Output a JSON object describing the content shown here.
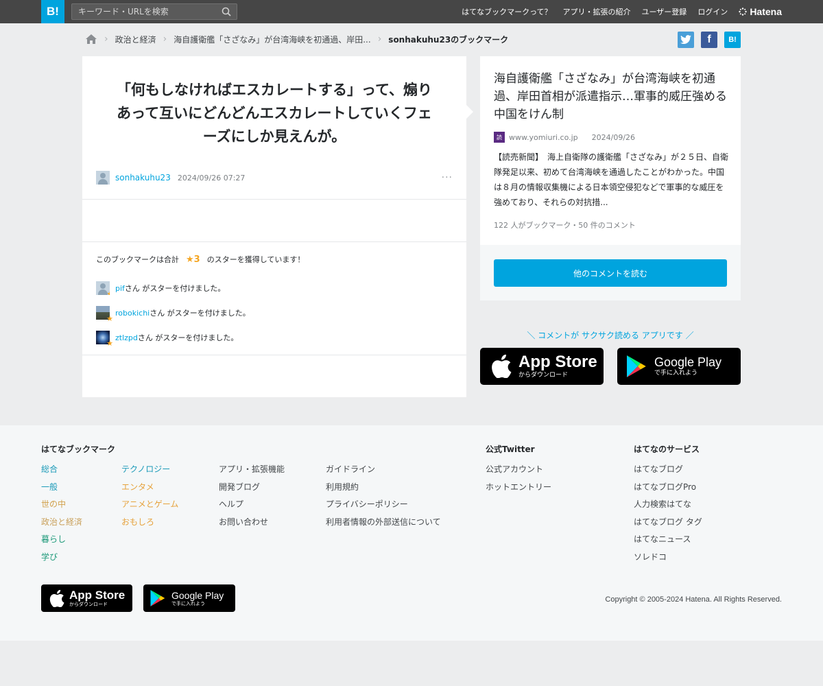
{
  "header": {
    "logo": "B!",
    "search_placeholder": "キーワード・URLを検索",
    "nav": [
      "はてなブックマークって？",
      "アプリ・拡張の紹介",
      "ユーザー登録",
      "ログイン"
    ],
    "brand": "Hatena"
  },
  "breadcrumb": {
    "items": [
      "政治と経済",
      "海自護衛艦「さざなみ」が台湾海峡を初通過、岸田...",
      "sonhakuhu23のブックマーク"
    ]
  },
  "share": {
    "twitter": "t",
    "facebook": "f",
    "hatena": "B!"
  },
  "comment": {
    "text": "「何もしなければエスカレートする」って、煽りあって互いにどんどんエスカレートしていくフェーズにしか見えんが。",
    "author": "sonhakuhu23",
    "time": "2024/09/26 07:27",
    "more": "···"
  },
  "stars": {
    "summary_prefix": "このブックマークは合計",
    "count": "★3",
    "summary_suffix": "のスターを獲得しています！",
    "users": [
      {
        "name": "pif",
        "text": "さん がスターを付けました。",
        "avatar_color": "#c5d4e0"
      },
      {
        "name": "robokichi",
        "text": "さん がスターを付けました。",
        "avatar_color": "#6a7d90"
      },
      {
        "name": "ztlzpd",
        "text": "さん がスターを付けました。",
        "avatar_color": "#1a2b55"
      }
    ]
  },
  "entry": {
    "title": "海自護衛艦「さざなみ」が台湾海峡を初通過、岸田首相が派遣指示…軍事的威圧強める中国をけん制",
    "favicon": "読",
    "domain": "www.yomiuri.co.jp",
    "date": "2024/09/26",
    "summary": "【読売新聞】　海上自衛隊の護衛艦「さざなみ」が２５日、自衛隊発足以来、初めて台湾海峡を通過したことがわかった。中国は８月の情報収集機による日本領空侵犯などで軍事的な威圧を強めており、それらの対抗措...",
    "count": "122 人がブックマーク・50 件のコメント",
    "readmore": "他のコメントを読む"
  },
  "app_promo": {
    "text": "＼ コメントが サクサク読める アプリです ／",
    "appstore_name": "App Store",
    "appstore_sub": "からダウンロード",
    "googleplay_name": "Google Play",
    "googleplay_sub": "で手に入れよう"
  },
  "footer": {
    "heading_bookmark": "はてなブックマーク",
    "categories_left": [
      "総合",
      "一般",
      "世の中",
      "政治と経済",
      "暮らし",
      "学び"
    ],
    "categories_right": [
      "テクノロジー",
      "エンタメ",
      "アニメとゲーム",
      "おもしろ"
    ],
    "links_a": [
      "アプリ・拡張機能",
      "開発ブログ",
      "ヘルプ",
      "お問い合わせ"
    ],
    "links_b": [
      "ガイドライン",
      "利用規約",
      "プライバシーポリシー",
      "利用者情報の外部送信について"
    ],
    "heading_twitter": "公式Twitter",
    "twitter_links": [
      "公式アカウント",
      "ホットエントリー"
    ],
    "heading_services": "はてなのサービス",
    "services": [
      "はてなブログ",
      "はてなブログPro",
      "人力検索はてな",
      "はてなブログ タグ",
      "はてなニュース",
      "ソレドコ"
    ],
    "copyright": "Copyright © 2005-2024 Hatena. All Rights Reserved."
  },
  "colors": {
    "accent": "#00a4de",
    "header_bg": "#464646",
    "star": "#f5a623",
    "category_colors": [
      "#1a9ab8",
      "#1a9ab8",
      "#d1a04a",
      "#d1a04a",
      "#1e9a7a",
      "#1e9a7a"
    ],
    "category_right_colors": [
      "#1a9ab8",
      "#e6a23c",
      "#e6a23c",
      "#e6a23c"
    ]
  }
}
